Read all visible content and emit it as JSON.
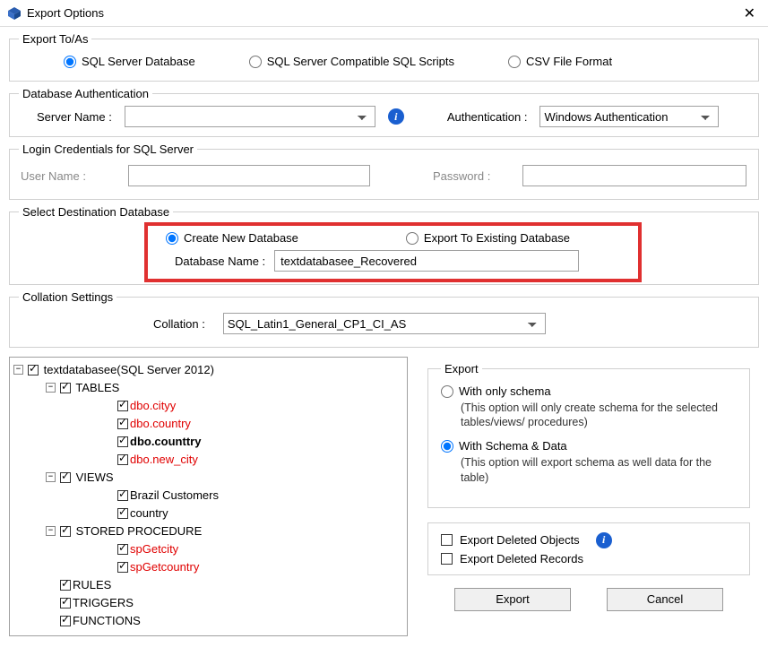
{
  "window": {
    "title": "Export Options"
  },
  "exportTo": {
    "legend": "Export To/As",
    "opt1": "SQL Server Database",
    "opt2": "SQL Server Compatible SQL Scripts",
    "opt3": "CSV File Format"
  },
  "auth": {
    "legend": "Database Authentication",
    "serverNameLabel": "Server Name :",
    "serverName": "",
    "authLabel": "Authentication :",
    "authValue": "Windows Authentication"
  },
  "login": {
    "legend": "Login Credentials for SQL Server",
    "userLabel": "User Name :",
    "userValue": "",
    "passLabel": "Password :",
    "passValue": ""
  },
  "dest": {
    "legend": "Select Destination Database",
    "opt1": "Create New Database",
    "opt2": "Export To Existing Database",
    "dbNameLabel": "Database Name :",
    "dbName": "textdatabasee_Recovered"
  },
  "collation": {
    "legend": "Collation Settings",
    "label": "Collation :",
    "value": "SQL_Latin1_General_CP1_CI_AS"
  },
  "tree": {
    "root": "textdatabasee(SQL Server 2012)",
    "tables": {
      "label": "TABLES",
      "items": [
        "dbo.cityy",
        "dbo.country",
        "dbo.counttry",
        "dbo.new_city"
      ]
    },
    "views": {
      "label": "VIEWS",
      "items": [
        "Brazil Customers",
        "country"
      ]
    },
    "sp": {
      "label": "STORED PROCEDURE",
      "items": [
        "spGetcity",
        "spGetcountry"
      ]
    },
    "rules": "RULES",
    "triggers": "TRIGGERS",
    "functions": "FUNCTIONS"
  },
  "export": {
    "legend": "Export",
    "schemaOnly": "With only schema",
    "schemaOnlyDesc": "(This option will only create schema for the  selected tables/views/ procedures)",
    "schemaData": "With Schema & Data",
    "schemaDataDesc": "(This option will export schema as well data for the table)",
    "delObjLabel": "Export Deleted Objects",
    "delRecLabel": "Export Deleted Records"
  },
  "buttons": {
    "export": "Export",
    "cancel": "Cancel"
  }
}
